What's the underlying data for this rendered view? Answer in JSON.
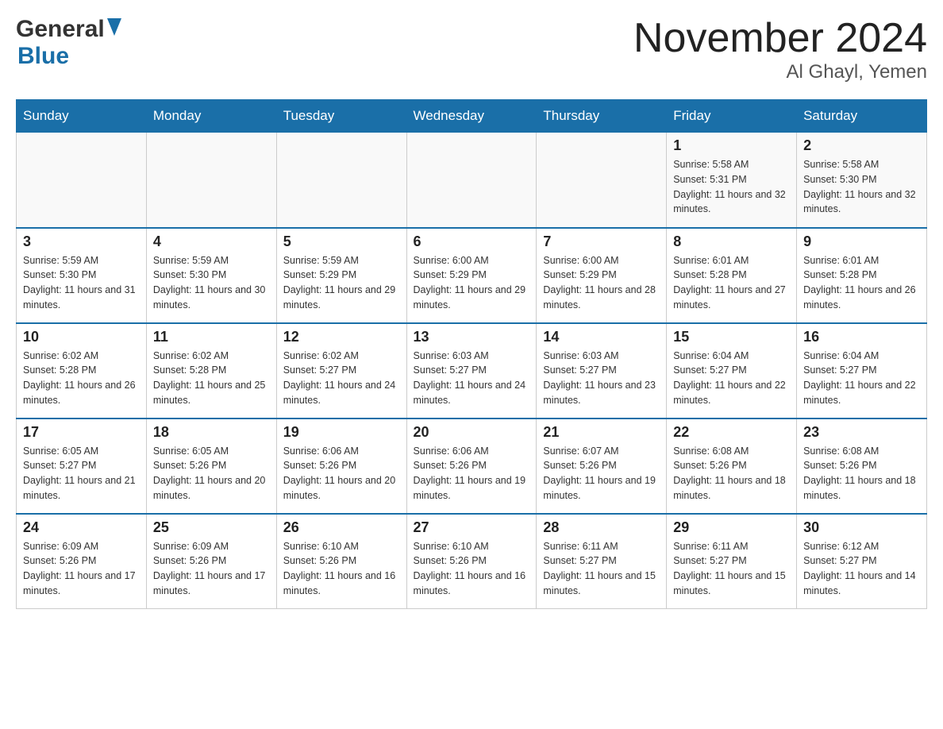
{
  "header": {
    "logo_general": "General",
    "logo_blue": "Blue",
    "title": "November 2024",
    "subtitle": "Al Ghayl, Yemen"
  },
  "weekdays": [
    "Sunday",
    "Monday",
    "Tuesday",
    "Wednesday",
    "Thursday",
    "Friday",
    "Saturday"
  ],
  "weeks": [
    [
      {
        "day": "",
        "info": ""
      },
      {
        "day": "",
        "info": ""
      },
      {
        "day": "",
        "info": ""
      },
      {
        "day": "",
        "info": ""
      },
      {
        "day": "",
        "info": ""
      },
      {
        "day": "1",
        "info": "Sunrise: 5:58 AM\nSunset: 5:31 PM\nDaylight: 11 hours and 32 minutes."
      },
      {
        "day": "2",
        "info": "Sunrise: 5:58 AM\nSunset: 5:30 PM\nDaylight: 11 hours and 32 minutes."
      }
    ],
    [
      {
        "day": "3",
        "info": "Sunrise: 5:59 AM\nSunset: 5:30 PM\nDaylight: 11 hours and 31 minutes."
      },
      {
        "day": "4",
        "info": "Sunrise: 5:59 AM\nSunset: 5:30 PM\nDaylight: 11 hours and 30 minutes."
      },
      {
        "day": "5",
        "info": "Sunrise: 5:59 AM\nSunset: 5:29 PM\nDaylight: 11 hours and 29 minutes."
      },
      {
        "day": "6",
        "info": "Sunrise: 6:00 AM\nSunset: 5:29 PM\nDaylight: 11 hours and 29 minutes."
      },
      {
        "day": "7",
        "info": "Sunrise: 6:00 AM\nSunset: 5:29 PM\nDaylight: 11 hours and 28 minutes."
      },
      {
        "day": "8",
        "info": "Sunrise: 6:01 AM\nSunset: 5:28 PM\nDaylight: 11 hours and 27 minutes."
      },
      {
        "day": "9",
        "info": "Sunrise: 6:01 AM\nSunset: 5:28 PM\nDaylight: 11 hours and 26 minutes."
      }
    ],
    [
      {
        "day": "10",
        "info": "Sunrise: 6:02 AM\nSunset: 5:28 PM\nDaylight: 11 hours and 26 minutes."
      },
      {
        "day": "11",
        "info": "Sunrise: 6:02 AM\nSunset: 5:28 PM\nDaylight: 11 hours and 25 minutes."
      },
      {
        "day": "12",
        "info": "Sunrise: 6:02 AM\nSunset: 5:27 PM\nDaylight: 11 hours and 24 minutes."
      },
      {
        "day": "13",
        "info": "Sunrise: 6:03 AM\nSunset: 5:27 PM\nDaylight: 11 hours and 24 minutes."
      },
      {
        "day": "14",
        "info": "Sunrise: 6:03 AM\nSunset: 5:27 PM\nDaylight: 11 hours and 23 minutes."
      },
      {
        "day": "15",
        "info": "Sunrise: 6:04 AM\nSunset: 5:27 PM\nDaylight: 11 hours and 22 minutes."
      },
      {
        "day": "16",
        "info": "Sunrise: 6:04 AM\nSunset: 5:27 PM\nDaylight: 11 hours and 22 minutes."
      }
    ],
    [
      {
        "day": "17",
        "info": "Sunrise: 6:05 AM\nSunset: 5:27 PM\nDaylight: 11 hours and 21 minutes."
      },
      {
        "day": "18",
        "info": "Sunrise: 6:05 AM\nSunset: 5:26 PM\nDaylight: 11 hours and 20 minutes."
      },
      {
        "day": "19",
        "info": "Sunrise: 6:06 AM\nSunset: 5:26 PM\nDaylight: 11 hours and 20 minutes."
      },
      {
        "day": "20",
        "info": "Sunrise: 6:06 AM\nSunset: 5:26 PM\nDaylight: 11 hours and 19 minutes."
      },
      {
        "day": "21",
        "info": "Sunrise: 6:07 AM\nSunset: 5:26 PM\nDaylight: 11 hours and 19 minutes."
      },
      {
        "day": "22",
        "info": "Sunrise: 6:08 AM\nSunset: 5:26 PM\nDaylight: 11 hours and 18 minutes."
      },
      {
        "day": "23",
        "info": "Sunrise: 6:08 AM\nSunset: 5:26 PM\nDaylight: 11 hours and 18 minutes."
      }
    ],
    [
      {
        "day": "24",
        "info": "Sunrise: 6:09 AM\nSunset: 5:26 PM\nDaylight: 11 hours and 17 minutes."
      },
      {
        "day": "25",
        "info": "Sunrise: 6:09 AM\nSunset: 5:26 PM\nDaylight: 11 hours and 17 minutes."
      },
      {
        "day": "26",
        "info": "Sunrise: 6:10 AM\nSunset: 5:26 PM\nDaylight: 11 hours and 16 minutes."
      },
      {
        "day": "27",
        "info": "Sunrise: 6:10 AM\nSunset: 5:26 PM\nDaylight: 11 hours and 16 minutes."
      },
      {
        "day": "28",
        "info": "Sunrise: 6:11 AM\nSunset: 5:27 PM\nDaylight: 11 hours and 15 minutes."
      },
      {
        "day": "29",
        "info": "Sunrise: 6:11 AM\nSunset: 5:27 PM\nDaylight: 11 hours and 15 minutes."
      },
      {
        "day": "30",
        "info": "Sunrise: 6:12 AM\nSunset: 5:27 PM\nDaylight: 11 hours and 14 minutes."
      }
    ]
  ]
}
